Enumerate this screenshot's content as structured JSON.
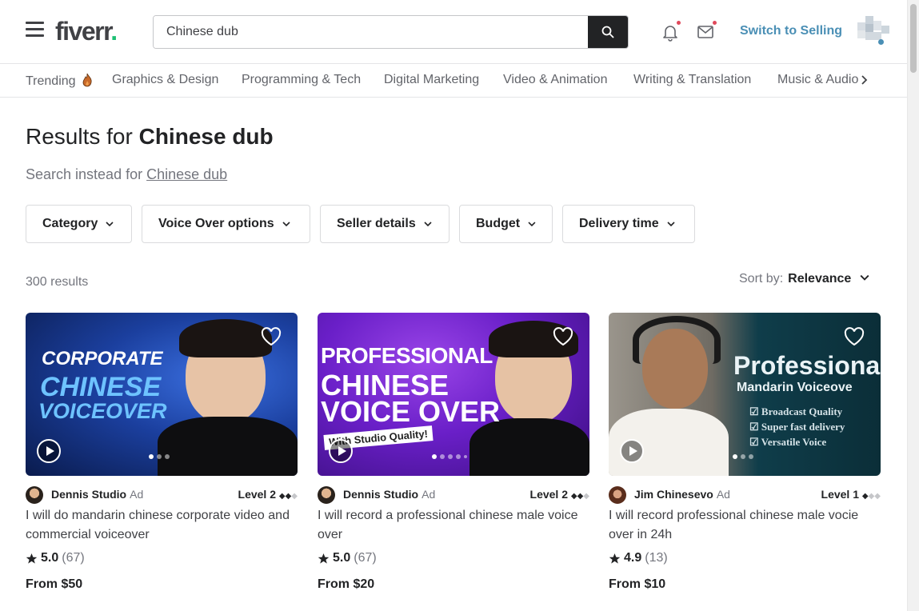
{
  "header": {
    "logo": "fiverr",
    "logo_dot": ".",
    "search_value": "Chinese dub",
    "switch_label": "Switch to Selling"
  },
  "categories": [
    "Trending",
    "Graphics & Design",
    "Programming & Tech",
    "Digital Marketing",
    "Video & Animation",
    "Writing & Translation",
    "Music & Audio"
  ],
  "results": {
    "prefix": "Results for",
    "query": "Chinese dub",
    "search_instead_prefix": "Search instead for",
    "search_instead_link": "Chinese dub",
    "count": "300 results",
    "sort_label": "Sort by:",
    "sort_value": "Relevance"
  },
  "filters": [
    "Category",
    "Voice Over options",
    "Seller details",
    "Budget",
    "Delivery time"
  ],
  "gigs": [
    {
      "seller": "Dennis Studio",
      "ad": "Ad",
      "level": "Level 2",
      "title": "I will do mandarin chinese corporate video and commercial voiceover",
      "rating": "5.0",
      "reviews": "(67)",
      "price": "From $50",
      "thumb_lines": [
        "CORPORATE",
        "CHINESE",
        "VOICEOVER"
      ]
    },
    {
      "seller": "Dennis Studio",
      "ad": "Ad",
      "level": "Level 2",
      "title": "I will record a professional chinese male voice over",
      "rating": "5.0",
      "reviews": "(67)",
      "price": "From $20",
      "thumb_lines": [
        "PROFESSIONAL",
        "CHINESE",
        "VOICE OVER",
        "With Studio Quality!"
      ]
    },
    {
      "seller": "Jim Chinesevo",
      "ad": "Ad",
      "level": "Level 1",
      "title": "I will record professional chinese male vocie over in 24h",
      "rating": "4.9",
      "reviews": "(13)",
      "price": "From $10",
      "thumb_lines": [
        "Professional",
        "Mandarin Voiceove",
        "Broadcast Quality",
        "Super fast delivery",
        "Versatile Voice"
      ]
    }
  ],
  "colors": {
    "accent": "#1dbf73",
    "switch": "#4a8fb5",
    "dark": "#222325"
  }
}
